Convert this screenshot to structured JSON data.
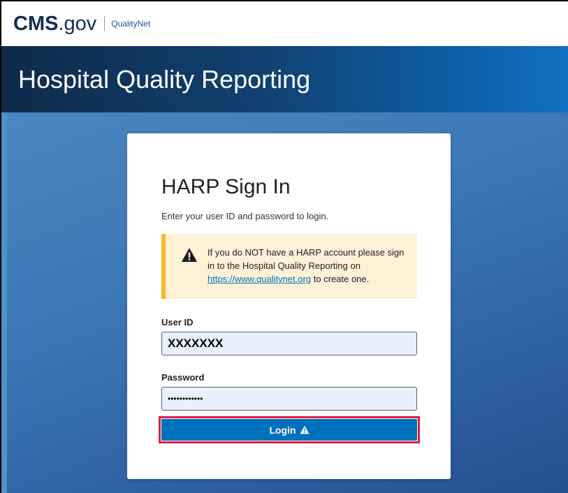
{
  "header": {
    "logo_cms": "CMS",
    "logo_gov": ".gov",
    "logo_product": "QualityNet"
  },
  "hero": {
    "title": "Hospital Quality Reporting"
  },
  "signin": {
    "title": "HARP Sign In",
    "subtitle": "Enter your user ID and password to login.",
    "alert": {
      "icon": "warning-icon",
      "text_before": "If you do NOT have a HARP account please sign in to the Hospital Quality Reporting on ",
      "link": "https://www.qualitynet.org",
      "text_after": " to create one."
    },
    "user_id": {
      "label": "User ID",
      "value": "XXXXXXX"
    },
    "password": {
      "label": "Password",
      "value": "••••••••••••"
    },
    "login_button": {
      "label": "Login",
      "icon": "warning-icon"
    }
  },
  "colors": {
    "brand_navy": "#112e51",
    "primary_blue": "#0071bc",
    "alert_bg": "#fdf1d6",
    "alert_border": "#fdb81e",
    "highlight_red": "#e31c3d"
  }
}
